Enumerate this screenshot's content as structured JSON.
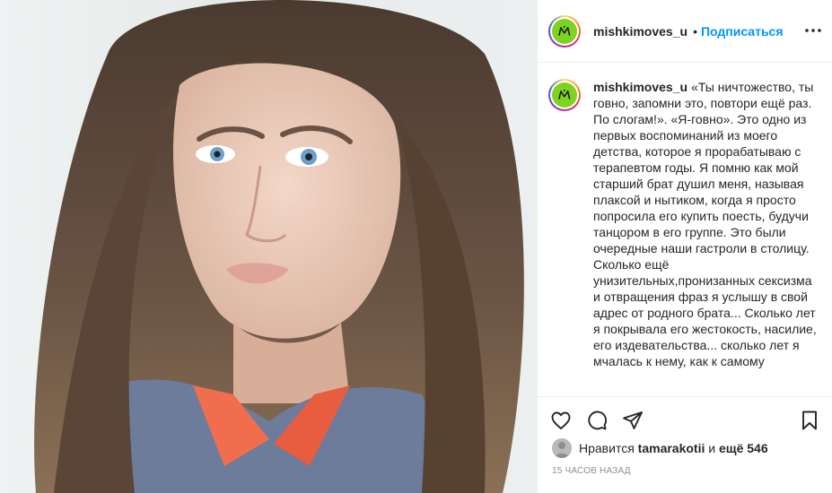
{
  "post": {
    "username": "mishkimoves_u",
    "follow_label": "Подписаться",
    "separator": "•",
    "caption": "«Ты ничтожество, ты говно, запомни это, повтори ещё раз. По слогам!». «Я-говно». Это одно из первых воспоминаний из моего детства, которое я прорабатываю с терапевтом годы. Я помню как мой старший брат душил меня, называя плаксой и нытиком, когда я просто попросила его купить поесть, будучи танцором в его группе. Это были очередные наши гастроли в столицу. Сколько ещё унизительных,пронизанных сексизма и отвращения фраз я услышу в свой адрес от родного брата... Сколько лет я покрывала его жестокость, насилие, его издевательства... сколько лет я мчалась к нему, как к самому",
    "likes_prefix": "Нравится",
    "likes_user": "tamarakotii",
    "likes_middle": "и",
    "likes_count": "ещё 546",
    "timestamp": "15 часов назад"
  },
  "icons": {
    "like": "heart-icon",
    "comment": "comment-icon",
    "share": "paper-plane-icon",
    "save": "bookmark-icon",
    "more": "more-horizontal-icon"
  },
  "colors": {
    "link": "#0095f6",
    "avatar_bg": "#7ed321",
    "text": "#262626",
    "muted": "#8e8e8e"
  }
}
